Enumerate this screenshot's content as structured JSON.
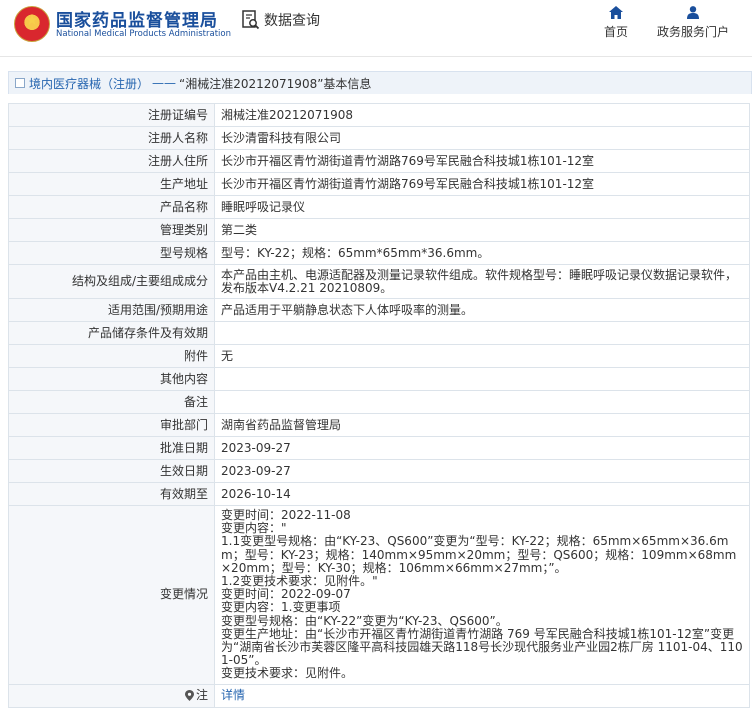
{
  "header": {
    "org_name_cn": "国家药品监督管理局",
    "org_name_en": "National Medical Products Administration",
    "query_label": "数据查询",
    "nav": [
      {
        "label": "首页",
        "icon": "home-icon"
      },
      {
        "label": "政务服务门户",
        "icon": "user-icon"
      }
    ]
  },
  "breadcrumb": {
    "link": "境内医疗器械（注册）",
    "separator": "——",
    "title": "“湘械注准20212071908”基本信息"
  },
  "rows": [
    {
      "label": "注册证编号",
      "value": "湘械注准20212071908"
    },
    {
      "label": "注册人名称",
      "value": "长沙清雷科技有限公司"
    },
    {
      "label": "注册人住所",
      "value": "长沙市开福区青竹湖街道青竹湖路769号军民融合科技城1栋101-12室"
    },
    {
      "label": "生产地址",
      "value": "长沙市开福区青竹湖街道青竹湖路769号军民融合科技城1栋101-12室"
    },
    {
      "label": "产品名称",
      "value": "睡眠呼吸记录仪"
    },
    {
      "label": "管理类别",
      "value": "第二类"
    },
    {
      "label": "型号规格",
      "value": "型号：KY-22；规格：65mm*65mm*36.6mm。"
    },
    {
      "label": "结构及组成/主要组成成分",
      "value": "本产品由主机、电源适配器及测量记录软件组成。软件规格型号：睡眠呼吸记录仪数据记录软件，发布版本V4.2.21 20210809。"
    },
    {
      "label": "适用范围/预期用途",
      "value": "产品适用于平躺静息状态下人体呼吸率的测量。"
    },
    {
      "label": "产品储存条件及有效期",
      "value": ""
    },
    {
      "label": "附件",
      "value": "无"
    },
    {
      "label": "其他内容",
      "value": ""
    },
    {
      "label": "备注",
      "value": ""
    },
    {
      "label": "审批部门",
      "value": "湖南省药品监督管理局"
    },
    {
      "label": "批准日期",
      "value": "2023-09-27"
    },
    {
      "label": "生效日期",
      "value": "2023-09-27"
    },
    {
      "label": "有效期至",
      "value": "2026-10-14"
    }
  ],
  "change": {
    "label": "变更情况",
    "lines": [
      "变更时间：2022-11-08",
      "变更内容：\"",
      "1.1变更型号规格：由“KY-23、QS600”变更为“型号：KY-22；规格：65mm×65mm×36.6mm；型号：KY-23；规格：140mm×95mm×20mm；型号：QS600；规格：109mm×68mm×20mm；型号：KY-30；规格：106mm×66mm×27mm；”。",
      "1.2变更技术要求：见附件。\"",
      "变更时间：2022-09-07",
      "变更内容：1.变更事项",
      "变更型号规格：由“KY-22”变更为“KY-23、QS600”。",
      "变更生产地址：由“长沙市开福区青竹湖街道青竹湖路 769 号军民融合科技城1栋101-12室”变更为“湖南省长沙市芙蓉区隆平高科技园雄天路118号长沙现代服务业产业园2栋厂房 1101-04、1101-05”。",
      "变更技术要求：见附件。"
    ]
  },
  "note": {
    "label": "注",
    "icon": "pin-icon",
    "link": "详情"
  },
  "colors": {
    "brand_blue": "#1a4f9c",
    "link_blue": "#2766b0",
    "label_bg": "#f5f7fa",
    "border": "#dce3ea"
  }
}
